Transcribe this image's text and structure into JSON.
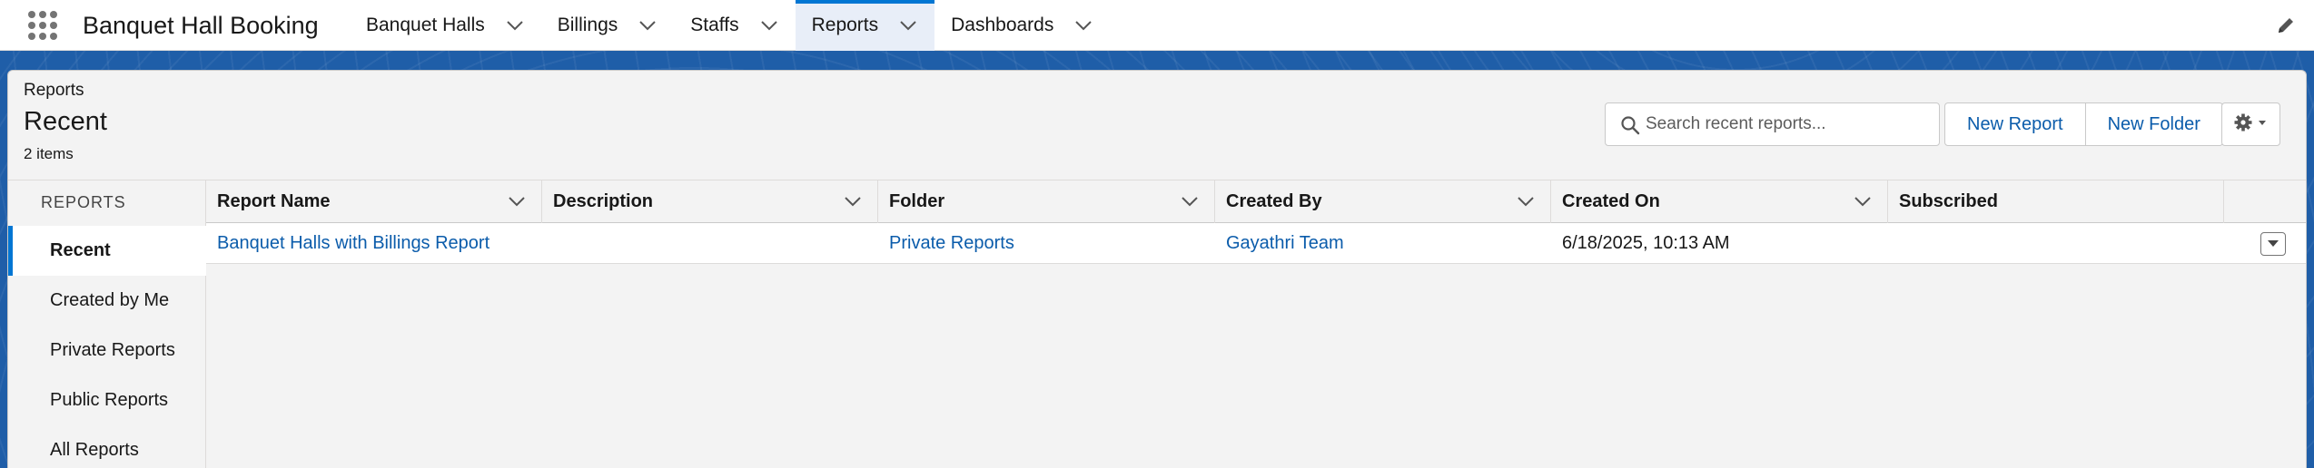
{
  "app": {
    "title": "Banquet Hall Booking"
  },
  "nav": {
    "items": [
      {
        "label": "Banquet Halls",
        "active": false
      },
      {
        "label": "Billings",
        "active": false
      },
      {
        "label": "Staffs",
        "active": false
      },
      {
        "label": "Reports",
        "active": true
      },
      {
        "label": "Dashboards",
        "active": false
      }
    ]
  },
  "header": {
    "eyebrow": "Reports",
    "title": "Recent",
    "item_count": "2 items"
  },
  "search": {
    "placeholder": "Search recent reports...",
    "value": ""
  },
  "toolbar": {
    "new_report_label": "New Report",
    "new_folder_label": "New Folder"
  },
  "sidebar": {
    "heading": "Reports",
    "items": [
      {
        "label": "Recent",
        "active": true
      },
      {
        "label": "Created by Me",
        "active": false
      },
      {
        "label": "Private Reports",
        "active": false
      },
      {
        "label": "Public Reports",
        "active": false
      },
      {
        "label": "All Reports",
        "active": false
      }
    ]
  },
  "table": {
    "columns": [
      "Report Name",
      "Description",
      "Folder",
      "Created By",
      "Created On",
      "Subscribed"
    ],
    "rows": [
      {
        "report_name": "Banquet Halls with Billings Report",
        "description": "",
        "folder": "Private Reports",
        "created_by": "Gayathri Team",
        "created_on": "6/18/2025, 10:13 AM",
        "subscribed": ""
      }
    ]
  },
  "colors": {
    "brand_blue": "#0176d3",
    "link_blue": "#0b5cab",
    "band_blue": "#1f5ea8"
  }
}
